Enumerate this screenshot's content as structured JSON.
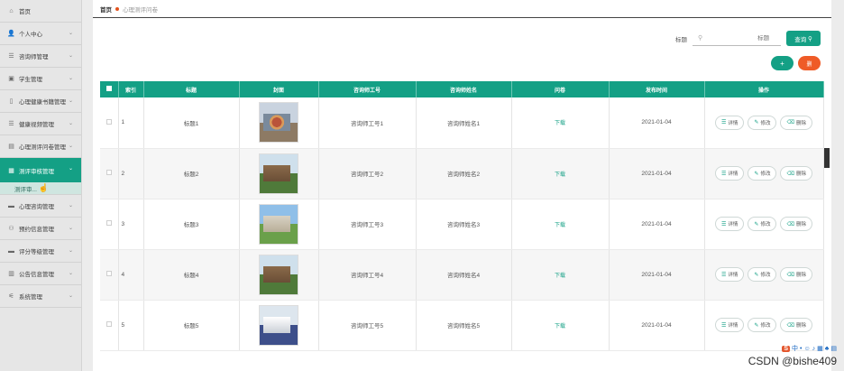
{
  "sidebar": {
    "items": [
      {
        "icon": "home-icon",
        "glyph": "⌂",
        "label": "首页",
        "chevron": false
      },
      {
        "icon": "user-icon",
        "glyph": "👤",
        "label": "个人中心",
        "chevron": true
      },
      {
        "icon": "list-icon",
        "glyph": "☰",
        "label": "咨询师管理",
        "chevron": true
      },
      {
        "icon": "student-icon",
        "glyph": "▣",
        "label": "学生管理",
        "chevron": true
      },
      {
        "icon": "book-icon",
        "glyph": "▯",
        "label": "心理健康书籍管理",
        "chevron": true
      },
      {
        "icon": "list-icon",
        "glyph": "☰",
        "label": "健康视频管理",
        "chevron": true
      },
      {
        "icon": "clipboard-icon",
        "glyph": "▤",
        "label": "心理测评问卷管理",
        "chevron": true
      }
    ],
    "active": {
      "icon": "grid-icon",
      "glyph": "▦",
      "label": "测评审核管理"
    },
    "sub": {
      "label": "测评审..."
    },
    "items_after": [
      {
        "icon": "chat-icon",
        "glyph": "▬",
        "label": "心理咨询管理",
        "chevron": true
      },
      {
        "icon": "calendar-icon",
        "glyph": "⚇",
        "label": "预约信息管理",
        "chevron": true
      },
      {
        "icon": "rating-icon",
        "glyph": "▬",
        "label": "评分等级管理",
        "chevron": true
      },
      {
        "icon": "notice-icon",
        "glyph": "▥",
        "label": "公告信息管理",
        "chevron": true
      },
      {
        "icon": "settings-icon",
        "glyph": "⚟",
        "label": "系统管理",
        "chevron": true
      }
    ]
  },
  "breadcrumb": {
    "home": "首页",
    "current": "心理测评问卷"
  },
  "search": {
    "label": "标题",
    "placeholder": "标题",
    "button": "查询"
  },
  "actions": {
    "add": "+",
    "delete": "删"
  },
  "table": {
    "headers": [
      "索引",
      "标题",
      "封面",
      "咨询师工号",
      "咨询师姓名",
      "问卷",
      "发布时间",
      "操作"
    ],
    "rows": [
      {
        "index": "1",
        "title": "标题1",
        "cover": "sculpture",
        "worker_id": "咨询师工号1",
        "worker_name": "咨询师姓名1",
        "file": "下载",
        "date": "2021-01-04"
      },
      {
        "index": "2",
        "title": "标题2",
        "cover": "building",
        "worker_id": "咨询师工号2",
        "worker_name": "咨询师姓名2",
        "file": "下载",
        "date": "2021-01-04"
      },
      {
        "index": "3",
        "title": "标题3",
        "cover": "campus",
        "worker_id": "咨询师工号3",
        "worker_name": "咨询师姓名3",
        "file": "下载",
        "date": "2021-01-04"
      },
      {
        "index": "4",
        "title": "标题4",
        "cover": "building",
        "worker_id": "咨询师工号4",
        "worker_name": "咨询师姓名4",
        "file": "下载",
        "date": "2021-01-04"
      },
      {
        "index": "5",
        "title": "标题5",
        "cover": "dorm",
        "worker_id": "咨询师工号5",
        "worker_name": "咨询师姓名5",
        "file": "下载",
        "date": "2021-01-04"
      }
    ],
    "ops": {
      "detail": "详情",
      "edit": "修改",
      "delete": "删除"
    }
  },
  "watermark": "CSDN @bishe409",
  "colors": {
    "accent": "#14a085",
    "danger": "#ef5b27"
  }
}
